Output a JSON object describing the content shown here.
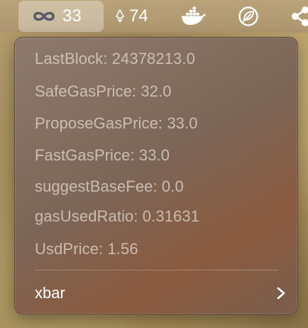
{
  "menubar": {
    "gas": {
      "icon": "infinity-icon",
      "value": "33"
    },
    "eth": {
      "icon": "ethereum-icon",
      "value": "74"
    },
    "docker": {
      "icon": "docker-icon"
    },
    "leaf": {
      "icon": "leaf-circle-icon"
    },
    "share": {
      "icon": "share-nodes-icon"
    }
  },
  "dropdown": {
    "items": [
      "LastBlock: 24378213.0",
      "SafeGasPrice: 32.0",
      "ProposeGasPrice: 33.0",
      "FastGasPrice: 33.0",
      "suggestBaseFee: 0.0",
      "gasUsedRatio: 0.31631",
      "UsdPrice: 1.56"
    ],
    "xbar_label": "xbar",
    "xbar_icon": "chevron-right-icon"
  },
  "colors": {
    "menubar_bg": "#b4a075",
    "menu_bg": "#806a5c",
    "menu_text_dim": "#c9b9ad",
    "menu_text": "#ffffff"
  }
}
